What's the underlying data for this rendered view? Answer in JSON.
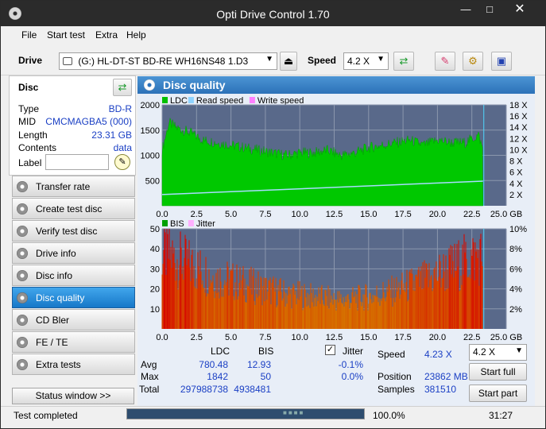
{
  "window": {
    "title": "Opti Drive Control 1.70"
  },
  "menu": {
    "items": [
      "File",
      "Start test",
      "Extra",
      "Help"
    ]
  },
  "toolbar": {
    "drive_label": "Drive",
    "drive_value": "(G:)   HL-DT-ST BD-RE  WH16NS48 1.D3",
    "speed_label": "Speed",
    "speed_value": "4.2 X"
  },
  "disc": {
    "header": "Disc",
    "fields": [
      {
        "label": "Type",
        "value": "BD-R"
      },
      {
        "label": "MID",
        "value": "CMCMAGBA5 (000)"
      },
      {
        "label": "Length",
        "value": "23.31 GB"
      },
      {
        "label": "Contents",
        "value": "data"
      }
    ],
    "label_label": "Label",
    "label_value": ""
  },
  "nav": {
    "items": [
      "Transfer rate",
      "Create test disc",
      "Verify test disc",
      "Drive info",
      "Disc info",
      "Disc quality",
      "CD Bler",
      "FE / TE",
      "Extra tests"
    ],
    "active_index": 5
  },
  "status_window_button": "Status window >>",
  "panel": {
    "title": "Disc quality"
  },
  "chart_data": [
    {
      "type": "area",
      "legend": [
        "LDC",
        "Read speed",
        "Write speed"
      ],
      "legend_colors": [
        "#00c000",
        "#8fd3ff",
        "#ff80ff"
      ],
      "x_ticks": [
        "0.0",
        "2.5",
        "5.0",
        "7.5",
        "10.0",
        "12.5",
        "15.0",
        "17.5",
        "20.0",
        "22.5",
        "25.0 GB"
      ],
      "xlim": [
        0,
        25
      ],
      "y_left_ticks": [
        "500",
        "1000",
        "1500",
        "2000"
      ],
      "ylim_left": [
        0,
        2000
      ],
      "y_right_ticks": [
        "2 X",
        "4 X",
        "6 X",
        "8 X",
        "10 X",
        "12 X",
        "14 X",
        "16 X",
        "18 X"
      ],
      "ylim_right": [
        0,
        18
      ],
      "ldc_x": [
        0,
        0.5,
        1,
        2,
        3,
        4,
        5,
        6,
        7,
        8,
        9,
        10,
        11,
        12,
        13,
        14,
        15,
        16,
        17,
        18,
        19,
        20,
        21,
        22,
        23,
        23.31
      ],
      "ldc_y": [
        1100,
        1650,
        1550,
        1450,
        1300,
        1250,
        1200,
        1150,
        1100,
        1050,
        1000,
        1050,
        1050,
        1100,
        1000,
        1050,
        1150,
        1200,
        1250,
        1300,
        1200,
        1300,
        1250,
        1250,
        1400,
        1100
      ],
      "read_speed_x": [
        0,
        23.31
      ],
      "read_speed_y": [
        2.0,
        4.4
      ]
    },
    {
      "type": "bar",
      "legend": [
        "BIS",
        "Jitter"
      ],
      "legend_colors": [
        "#00a000",
        "#ffb0ff"
      ],
      "x_ticks": [
        "0.0",
        "2.5",
        "5.0",
        "7.5",
        "10.0",
        "12.5",
        "15.0",
        "17.5",
        "20.0",
        "22.5",
        "25.0 GB"
      ],
      "xlim": [
        0,
        25
      ],
      "y_left_ticks": [
        "10",
        "20",
        "30",
        "40",
        "50"
      ],
      "ylim_left": [
        0,
        50
      ],
      "y_right_ticks": [
        "2%",
        "4%",
        "6%",
        "8%",
        "10%"
      ],
      "ylim_right": [
        0,
        10
      ],
      "bis_x": [
        0,
        1,
        2,
        3,
        4,
        5,
        6,
        7,
        8,
        9,
        10,
        11,
        12,
        13,
        14,
        15,
        16,
        17,
        18,
        19,
        20,
        21,
        22,
        23,
        23.31
      ],
      "bis_y": [
        48,
        44,
        40,
        36,
        32,
        30,
        28,
        26,
        24,
        22,
        21,
        20,
        19,
        18,
        19,
        20,
        22,
        24,
        27,
        30,
        34,
        38,
        42,
        46,
        44
      ]
    }
  ],
  "stats": {
    "headers": [
      "LDC",
      "BIS"
    ],
    "rows": [
      {
        "label": "Avg",
        "ldc": "780.48",
        "bis": "12.93",
        "jitter": "-0.1%"
      },
      {
        "label": "Max",
        "ldc": "1842",
        "bis": "50",
        "jitter": "0.0%"
      },
      {
        "label": "Total",
        "ldc": "297988738",
        "bis": "4938481"
      }
    ],
    "jitter_label": "Jitter",
    "jitter_checked": true,
    "speed_label": "Speed",
    "speed_value": "4.23 X",
    "speed_select": "4.2 X",
    "position_label": "Position",
    "position_value": "23862 MB",
    "samples_label": "Samples",
    "samples_value": "381510",
    "start_full": "Start full",
    "start_part": "Start part"
  },
  "status": {
    "text": "Test completed",
    "progress_percent": 100.0,
    "progress_label": "100.0%",
    "time": "31:27"
  }
}
